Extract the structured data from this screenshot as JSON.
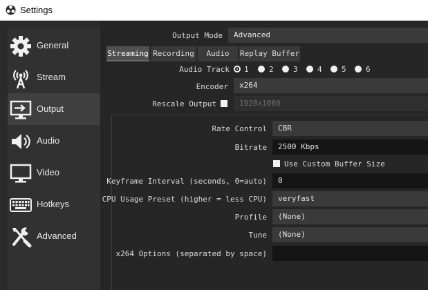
{
  "window": {
    "title": "Settings",
    "app_icon": "obs-logo-icon"
  },
  "sidebar": {
    "items": [
      {
        "label": "General",
        "icon": "gear-icon",
        "active": false
      },
      {
        "label": "Stream",
        "icon": "broadcast-antenna-icon",
        "active": false
      },
      {
        "label": "Output",
        "icon": "monitor-output-icon",
        "active": true
      },
      {
        "label": "Audio",
        "icon": "speaker-icon",
        "active": false
      },
      {
        "label": "Video",
        "icon": "monitor-icon",
        "active": false
      },
      {
        "label": "Hotkeys",
        "icon": "keyboard-icon",
        "active": false
      },
      {
        "label": "Advanced",
        "icon": "wrench-screwdriver-icon",
        "active": false
      }
    ]
  },
  "output": {
    "mode_label": "Output Mode",
    "mode_value": "Advanced",
    "tabs": [
      {
        "label": "Streaming",
        "active": true
      },
      {
        "label": "Recording",
        "active": false
      },
      {
        "label": "Audio",
        "active": false
      },
      {
        "label": "Replay Buffer",
        "active": false
      }
    ],
    "audio_track": {
      "label": "Audio Track",
      "options": [
        "1",
        "2",
        "3",
        "4",
        "5",
        "6"
      ],
      "selected": "1"
    },
    "encoder": {
      "label": "Encoder",
      "value": "x264"
    },
    "rescale": {
      "label": "Rescale Output",
      "checked": false,
      "value": "1920x1080"
    },
    "settings": {
      "rate_control": {
        "label": "Rate Control",
        "value": "CBR"
      },
      "bitrate": {
        "label": "Bitrate",
        "value": "2500 Kbps"
      },
      "custom_buffer": {
        "label": "Use Custom Buffer Size",
        "checked": false
      },
      "keyframe": {
        "label": "Keyframe Interval (seconds, 0=auto)",
        "value": "0"
      },
      "cpu_preset": {
        "label": "CPU Usage Preset (higher = less CPU)",
        "value": "veryfast"
      },
      "profile": {
        "label": "Profile",
        "value": "(None)"
      },
      "tune": {
        "label": "Tune",
        "value": "(None)"
      },
      "x264_options": {
        "label": "x264 Options (separated by space)",
        "value": ""
      }
    }
  },
  "colors": {
    "titlebar_bg": "#ffffff",
    "window_bg": "#2b2b2b",
    "content_bg": "#262626",
    "field_bg": "#3a3a3a",
    "active_sidebar_bg": "#3f3f3f"
  }
}
